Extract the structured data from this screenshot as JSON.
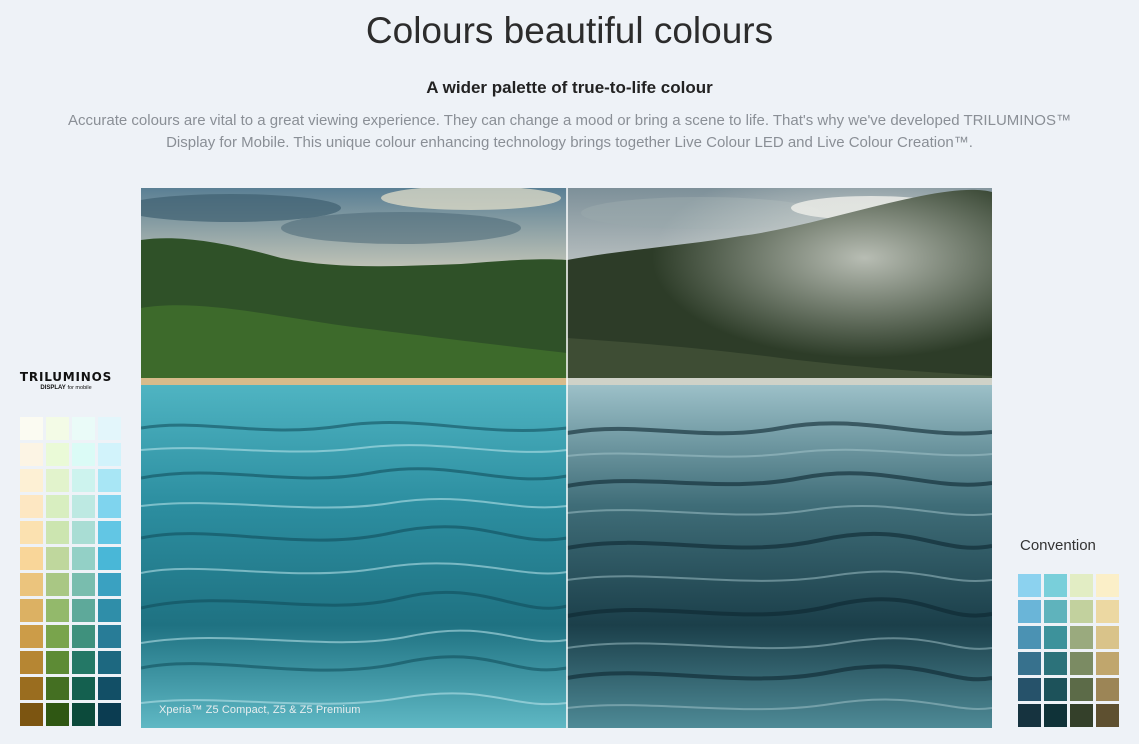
{
  "header": {
    "title": "Colours beautiful colours",
    "subtitle": "A wider palette of true-to-life colour",
    "description": "Accurate colours are vital to a great viewing experience. They can change a mood or bring a scene to life. That's why we've developed TRILUMINOS™ Display for Mobile. This unique colour enhancing technology brings together Live Colour LED and Live Colour Creation™."
  },
  "comparison": {
    "caption": "Xperia™ Z5 Compact, Z5 & Z5 Premium"
  },
  "triluminos": {
    "brand": "TRILUMINOS",
    "display": "DISPLAY",
    "suffix": "for mobile",
    "swatches": [
      [
        "#fbfbf2",
        "#f3fbe6",
        "#eafbf8",
        "#e3f6fb"
      ],
      [
        "#fcf4e4",
        "#eafad7",
        "#dbfbf6",
        "#d2f3fb"
      ],
      [
        "#fdf0d4",
        "#e2f3cc",
        "#cdf3ee",
        "#a8e6f5"
      ],
      [
        "#fde7c2",
        "#d8eec0",
        "#bde9e2",
        "#7fd4ee"
      ],
      [
        "#fbe1b0",
        "#cce5b0",
        "#a9ddd4",
        "#62c6e4"
      ],
      [
        "#f9d699",
        "#bfd79d",
        "#93d0c6",
        "#49b7d7"
      ],
      [
        "#ebc47d",
        "#a9c784",
        "#79bdae",
        "#3aa1c1"
      ],
      [
        "#dcb163",
        "#93b96b",
        "#5ea99a",
        "#2f8ea9"
      ],
      [
        "#cc9c48",
        "#79a44c",
        "#3f917d",
        "#287c97"
      ],
      [
        "#b68633",
        "#5d8b35",
        "#247866",
        "#1d6880"
      ],
      [
        "#9a6d1f",
        "#446f22",
        "#14604f",
        "#124f66"
      ],
      [
        "#7c5511",
        "#2f5713",
        "#0c4a3b",
        "#0b3c51"
      ]
    ]
  },
  "conventional": {
    "label": "Convention",
    "swatches": [
      [
        "#8cd2ef",
        "#79cfda",
        "#e2edc4",
        "#fbefc8"
      ],
      [
        "#6ab5d8",
        "#5fb3bc",
        "#c2d19e",
        "#ecd8a2"
      ],
      [
        "#4b92b3",
        "#3d929b",
        "#9aaa7e",
        "#d9c38a"
      ],
      [
        "#37718d",
        "#2c727a",
        "#7b8b63",
        "#c0a66d"
      ],
      [
        "#26526a",
        "#1d525a",
        "#5c6b48",
        "#9c8556"
      ],
      [
        "#16333f",
        "#0f3238",
        "#34402a",
        "#5e5030"
      ]
    ]
  }
}
